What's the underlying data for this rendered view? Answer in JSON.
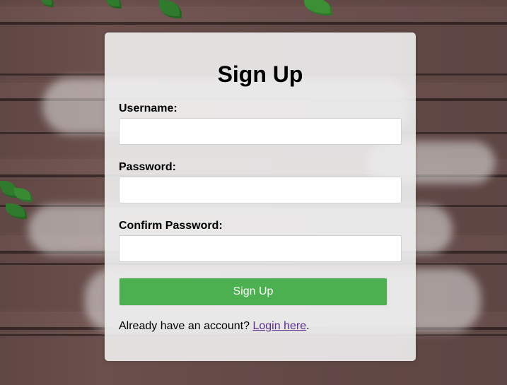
{
  "form": {
    "title": "Sign Up",
    "username_label": "Username:",
    "username_value": "",
    "password_label": "Password:",
    "password_value": "",
    "confirm_label": "Confirm Password:",
    "confirm_value": "",
    "submit_label": "Sign Up"
  },
  "footer": {
    "prompt": "Already have an account? ",
    "link_label": "Login here",
    "suffix": "."
  },
  "colors": {
    "button": "#4caf50",
    "link": "#5b2d8b",
    "card": "#f0f0f0"
  }
}
